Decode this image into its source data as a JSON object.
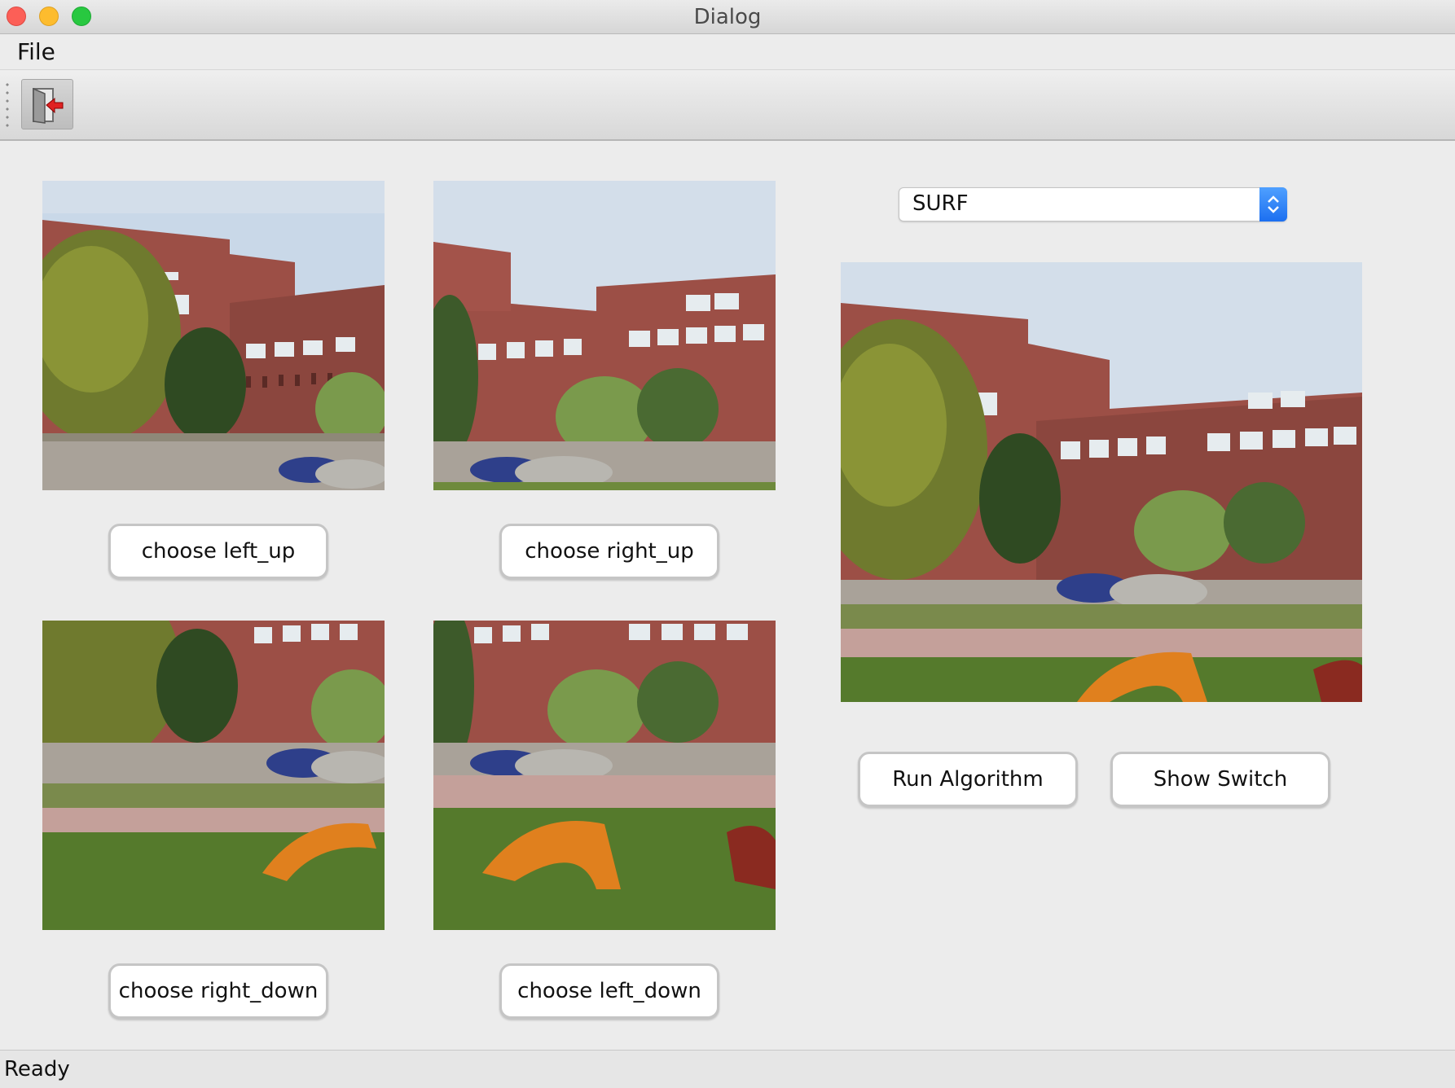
{
  "window": {
    "title": "Dialog"
  },
  "menubar": {
    "items": [
      {
        "label": "File"
      }
    ]
  },
  "toolbar": {
    "exit_icon": "exit-door-icon"
  },
  "images": {
    "left_up": "building-photo",
    "right_up": "building-photo",
    "bottom_left": "building-photo",
    "bottom_right": "building-photo",
    "result": "stitched-panorama-photo"
  },
  "buttons": {
    "choose_left_up": "choose left_up",
    "choose_right_up": "choose right_up",
    "choose_right_down": "choose right_down",
    "choose_left_down": "choose left_down",
    "run_algorithm": "Run Algorithm",
    "show_switch": "Show Switch"
  },
  "algorithm_select": {
    "value": "SURF",
    "accent": "#1c6ff0"
  },
  "status": {
    "text": "Ready"
  }
}
